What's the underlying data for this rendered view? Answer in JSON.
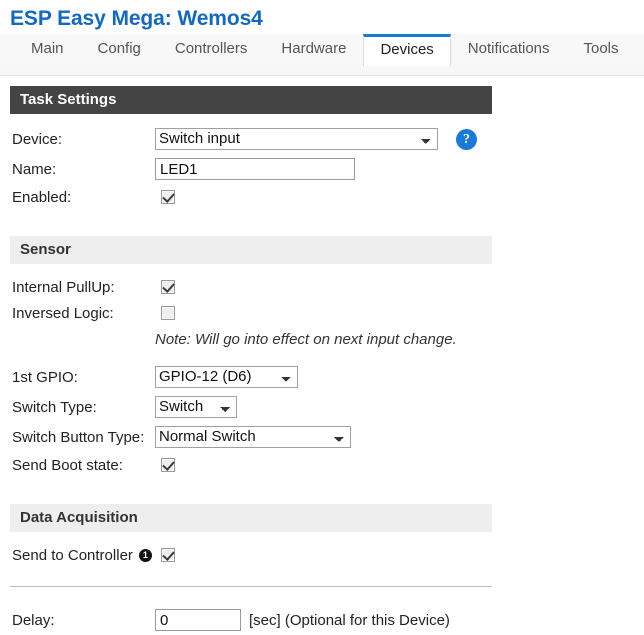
{
  "header": {
    "title": "ESP Easy Mega: Wemos4",
    "title_color": "#1269c4"
  },
  "tabs": [
    {
      "label": "Main",
      "active": false
    },
    {
      "label": "Config",
      "active": false
    },
    {
      "label": "Controllers",
      "active": false
    },
    {
      "label": "Hardware",
      "active": false
    },
    {
      "label": "Devices",
      "active": true
    },
    {
      "label": "Notifications",
      "active": false
    },
    {
      "label": "Tools",
      "active": false
    }
  ],
  "sections": {
    "task_settings": {
      "title": "Task Settings",
      "device": {
        "label": "Device:",
        "value": "Switch input",
        "options": [
          "Switch input"
        ],
        "help_icon": "question-mark-icon"
      },
      "name": {
        "label": "Name:",
        "value": "LED1",
        "placeholder": ""
      },
      "enabled": {
        "label": "Enabled:",
        "checked": true
      }
    },
    "sensor": {
      "title": "Sensor",
      "internal_pullup": {
        "label": "Internal PullUp:",
        "checked": true
      },
      "inversed_logic": {
        "label": "Inversed Logic:",
        "checked": false
      },
      "note": "Note: Will go into effect on next input change.",
      "first_gpio": {
        "label": "1st GPIO:",
        "value": "GPIO-12 (D6)",
        "options": [
          "GPIO-12 (D6)"
        ]
      },
      "switch_type": {
        "label": "Switch Type:",
        "value": "Switch",
        "options": [
          "Switch"
        ]
      },
      "switch_button_type": {
        "label": "Switch Button Type:",
        "value": "Normal Switch",
        "options": [
          "Normal Switch"
        ]
      },
      "send_boot_state": {
        "label": "Send Boot state:",
        "checked": true
      }
    },
    "data_acquisition": {
      "title": "Data Acquisition",
      "send_to_controller": {
        "label": "Send to Controller",
        "badge": "1",
        "checked": true
      },
      "delay": {
        "label": "Delay:",
        "value": "0",
        "suffix": "[sec] (Optional for this Device)"
      }
    }
  }
}
